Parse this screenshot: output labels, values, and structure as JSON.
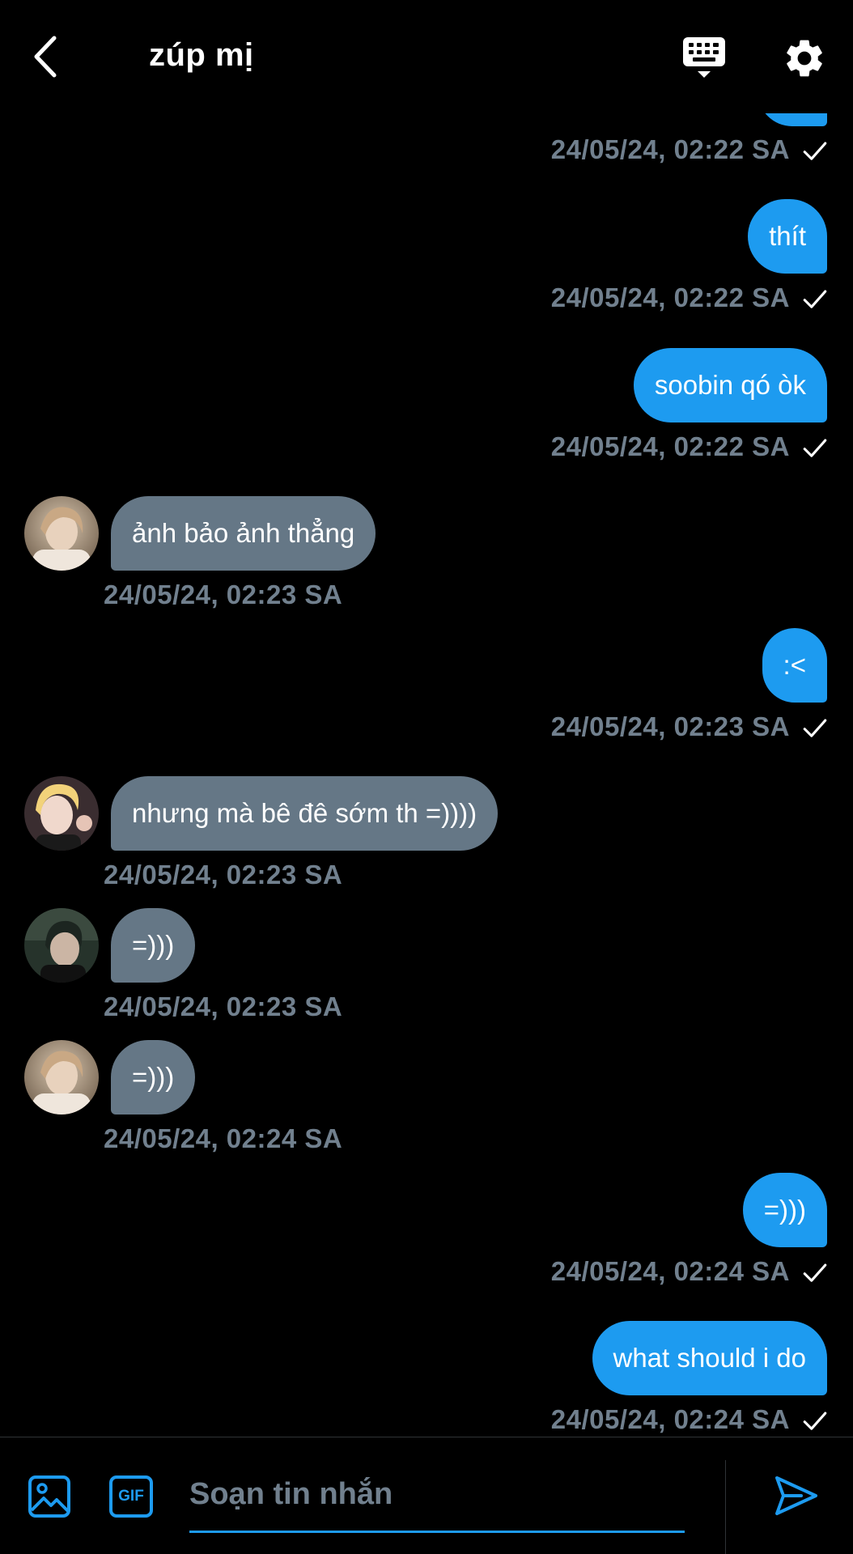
{
  "header": {
    "title": "zúp mị",
    "back_icon": "chevron-left-icon",
    "keyboard_icon": "keyboard-icon",
    "settings_icon": "gear-icon"
  },
  "colors": {
    "background": "#000000",
    "outgoing_bubble": "#1d9bf0",
    "incoming_bubble": "#657786",
    "timestamp": "#71808e",
    "accent": "#1d9bf0"
  },
  "messages": [
    {
      "direction": "out",
      "text": "",
      "timestamp": "24/05/24, 02:22 SA",
      "seen": true
    },
    {
      "direction": "out",
      "text": "thít",
      "timestamp": "24/05/24, 02:22 SA",
      "seen": true
    },
    {
      "direction": "out",
      "text": "soobin qó òk",
      "timestamp": "24/05/24, 02:22 SA",
      "seen": true
    },
    {
      "direction": "in",
      "text": "ảnh bảo ảnh thẳng",
      "timestamp": "24/05/24, 02:23 SA"
    },
    {
      "direction": "out",
      "text": ":<",
      "timestamp": "24/05/24, 02:23 SA",
      "seen": true
    },
    {
      "direction": "in",
      "text": "nhưng mà bê đê sớm th =))))",
      "timestamp": "24/05/24, 02:23 SA"
    },
    {
      "direction": "in",
      "text": "=)))",
      "timestamp": "24/05/24, 02:23 SA"
    },
    {
      "direction": "in",
      "text": "=)))",
      "timestamp": "24/05/24, 02:24 SA"
    },
    {
      "direction": "out",
      "text": "=)))",
      "timestamp": "24/05/24, 02:24 SA",
      "seen": true
    },
    {
      "direction": "out",
      "text": "what should i do",
      "timestamp": "24/05/24, 02:24 SA",
      "seen": true
    }
  ],
  "composer": {
    "placeholder": "Soạn tin nhắn",
    "media_icon": "image-icon",
    "gif_label": "GIF",
    "send_icon": "send-icon"
  }
}
